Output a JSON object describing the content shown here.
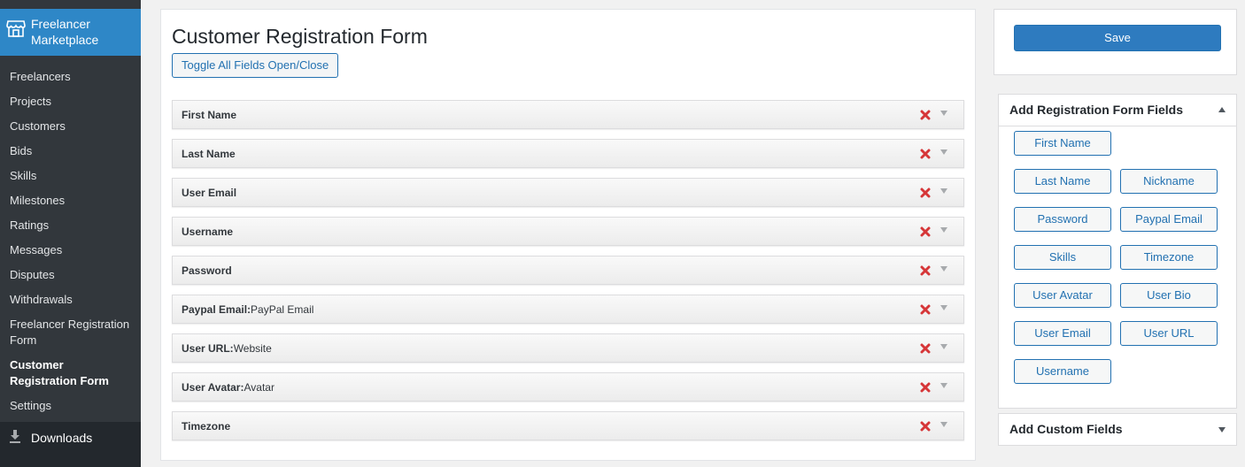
{
  "sidebar": {
    "active_menu": "Freelancer Marketplace",
    "items": [
      {
        "label": "Freelancers"
      },
      {
        "label": "Projects"
      },
      {
        "label": "Customers"
      },
      {
        "label": "Bids"
      },
      {
        "label": "Skills"
      },
      {
        "label": "Milestones"
      },
      {
        "label": "Ratings"
      },
      {
        "label": "Messages"
      },
      {
        "label": "Disputes"
      },
      {
        "label": "Withdrawals"
      },
      {
        "label": "Freelancer Registration Form"
      },
      {
        "label": "Customer Registration Form"
      },
      {
        "label": "Settings"
      }
    ],
    "downloads": "Downloads"
  },
  "main": {
    "title": "Customer Registration Form",
    "toggle_label": "Toggle All Fields Open/Close",
    "fields": [
      {
        "name": "First Name",
        "extra": ""
      },
      {
        "name": "Last Name",
        "extra": ""
      },
      {
        "name": "User Email",
        "extra": ""
      },
      {
        "name": "Username",
        "extra": ""
      },
      {
        "name": "Password",
        "extra": ""
      },
      {
        "name": "Paypal Email:",
        "extra": " PayPal Email"
      },
      {
        "name": "User URL:",
        "extra": " Website"
      },
      {
        "name": "User Avatar:",
        "extra": " Avatar"
      },
      {
        "name": "Timezone",
        "extra": ""
      }
    ]
  },
  "right": {
    "save_label": "Save",
    "add_fields_title": "Add Registration Form Fields",
    "add_fields": [
      "First Name",
      "Last Name",
      "Nickname",
      "Password",
      "Paypal Email",
      "Skills",
      "Timezone",
      "User Avatar",
      "User Bio",
      "User Email",
      "User URL",
      "Username"
    ],
    "custom_fields_title": "Add Custom Fields"
  },
  "colors": {
    "sidebar_bg": "#23282d",
    "sidebar_active": "#2e87c7",
    "accent": "#2271b1",
    "delete": "#d63638"
  }
}
